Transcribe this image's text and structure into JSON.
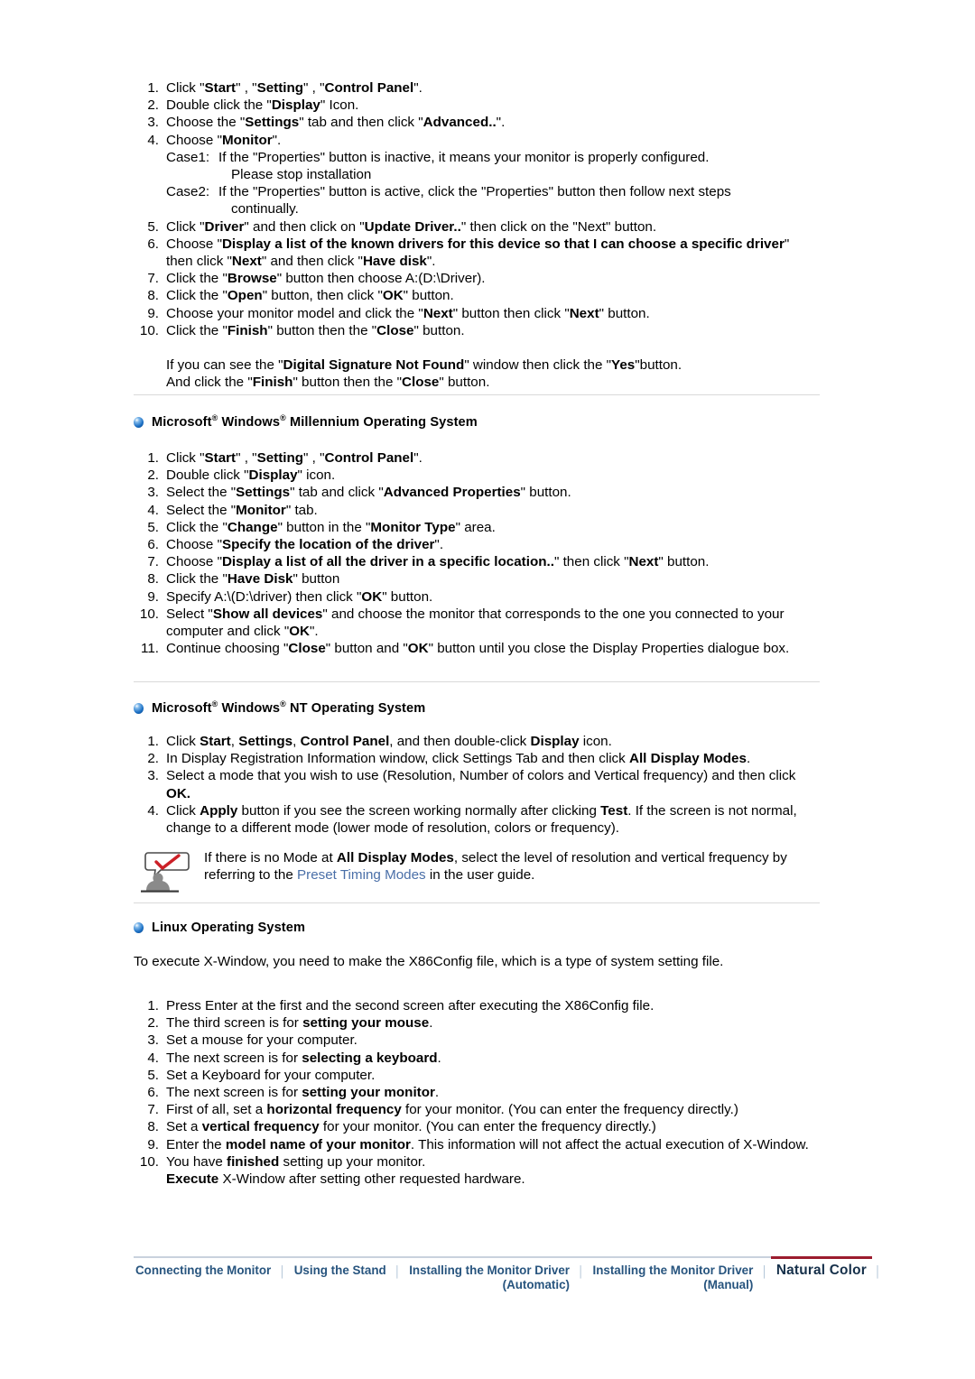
{
  "section_xp": {
    "steps": [
      {
        "n": "1.",
        "parts": [
          {
            "t": "Click \"",
            "b": false
          },
          {
            "t": "Start",
            "b": true
          },
          {
            "t": "\" , \"",
            "b": false
          },
          {
            "t": "Setting",
            "b": true
          },
          {
            "t": "\" , \"",
            "b": false
          },
          {
            "t": "Control Panel",
            "b": true
          },
          {
            "t": "\".",
            "b": false
          }
        ]
      },
      {
        "n": "2.",
        "parts": [
          {
            "t": "Double click the \"",
            "b": false
          },
          {
            "t": "Display",
            "b": true
          },
          {
            "t": "\" Icon.",
            "b": false
          }
        ]
      },
      {
        "n": "3.",
        "parts": [
          {
            "t": "Choose the \"",
            "b": false
          },
          {
            "t": "Settings",
            "b": true
          },
          {
            "t": "\" tab and then click \"",
            "b": false
          },
          {
            "t": "Advanced..",
            "b": true
          },
          {
            "t": "\".",
            "b": false
          }
        ]
      },
      {
        "n": "4.",
        "parts": [
          {
            "t": "Choose \"",
            "b": false
          },
          {
            "t": "Monitor",
            "b": true
          },
          {
            "t": "\".",
            "b": false
          }
        ]
      }
    ],
    "cases": [
      {
        "label": "Case1:",
        "lines": [
          "If the \"Properties\" button is inactive, it means your monitor is properly configured.",
          "Please stop installation"
        ]
      },
      {
        "label": "Case2:",
        "lines": [
          "If the \"Properties\" button is active, click the \"Properties\" button then follow next steps",
          "continually."
        ]
      }
    ],
    "steps2": [
      {
        "n": "5.",
        "parts": [
          {
            "t": "Click \"",
            "b": false
          },
          {
            "t": "Driver",
            "b": true
          },
          {
            "t": "\" and then click on \"",
            "b": false
          },
          {
            "t": "Update Driver..",
            "b": true
          },
          {
            "t": "\" then click on the \"Next\" button.",
            "b": false
          }
        ]
      },
      {
        "n": "6.",
        "parts": [
          {
            "t": "Choose \"",
            "b": false
          },
          {
            "t": "Display a list of the known drivers for this device so that I can choose a specific driver",
            "b": true
          },
          {
            "t": "\" then click \"",
            "b": false
          },
          {
            "t": "Next",
            "b": true
          },
          {
            "t": "\" and then click \"",
            "b": false
          },
          {
            "t": "Have disk",
            "b": true
          },
          {
            "t": "\".",
            "b": false
          }
        ]
      },
      {
        "n": "7.",
        "parts": [
          {
            "t": "Click the \"",
            "b": false
          },
          {
            "t": "Browse",
            "b": true
          },
          {
            "t": "\" button then choose A:(D:\\Driver).",
            "b": false
          }
        ]
      },
      {
        "n": "8.",
        "parts": [
          {
            "t": "Click the \"",
            "b": false
          },
          {
            "t": "Open",
            "b": true
          },
          {
            "t": "\" button, then click \"",
            "b": false
          },
          {
            "t": "OK",
            "b": true
          },
          {
            "t": "\" button.",
            "b": false
          }
        ]
      },
      {
        "n": "9.",
        "parts": [
          {
            "t": "Choose your monitor model and click the \"",
            "b": false
          },
          {
            "t": "Next",
            "b": true
          },
          {
            "t": "\" button then click \"",
            "b": false
          },
          {
            "t": "Next",
            "b": true
          },
          {
            "t": "\" button.",
            "b": false
          }
        ]
      },
      {
        "n": "10.",
        "parts": [
          {
            "t": "Click the \"",
            "b": false
          },
          {
            "t": "Finish",
            "b": true
          },
          {
            "t": "\" button then the \"",
            "b": false
          },
          {
            "t": "Close",
            "b": true
          },
          {
            "t": "\" button.",
            "b": false
          }
        ]
      }
    ],
    "note_lines": [
      [
        {
          "t": "If you can see the \"",
          "b": false
        },
        {
          "t": "Digital Signature Not Found",
          "b": true
        },
        {
          "t": "\" window then click the \"",
          "b": false
        },
        {
          "t": "Yes",
          "b": true
        },
        {
          "t": "\"button.",
          "b": false
        }
      ],
      [
        {
          "t": "And click the \"",
          "b": false
        },
        {
          "t": "Finish",
          "b": true
        },
        {
          "t": "\" button then the \"",
          "b": false
        },
        {
          "t": "Close",
          "b": true
        },
        {
          "t": "\" button.",
          "b": false
        }
      ]
    ]
  },
  "section_me": {
    "heading": {
      "icon": "blue-orb-bullet",
      "pre": "Microsoft",
      "reg1": "®",
      "mid": " Windows",
      "reg2": "®",
      "post": " Millennium Operating System"
    },
    "steps": [
      {
        "n": "1.",
        "parts": [
          {
            "t": "Click \"",
            "b": false
          },
          {
            "t": "Start",
            "b": true
          },
          {
            "t": "\" , \"",
            "b": false
          },
          {
            "t": "Setting",
            "b": true
          },
          {
            "t": "\" , \"",
            "b": false
          },
          {
            "t": "Control Panel",
            "b": true
          },
          {
            "t": "\".",
            "b": false
          }
        ]
      },
      {
        "n": "2.",
        "parts": [
          {
            "t": "Double click \"",
            "b": false
          },
          {
            "t": "Display",
            "b": true
          },
          {
            "t": "\" icon.",
            "b": false
          }
        ]
      },
      {
        "n": "3.",
        "parts": [
          {
            "t": "Select the \"",
            "b": false
          },
          {
            "t": "Settings",
            "b": true
          },
          {
            "t": "\" tab and click \"",
            "b": false
          },
          {
            "t": "Advanced Properties",
            "b": true
          },
          {
            "t": "\" button.",
            "b": false
          }
        ]
      },
      {
        "n": "4.",
        "parts": [
          {
            "t": "Select the \"",
            "b": false
          },
          {
            "t": "Monitor",
            "b": true
          },
          {
            "t": "\" tab.",
            "b": false
          }
        ]
      },
      {
        "n": "5.",
        "parts": [
          {
            "t": "Click the \"",
            "b": false
          },
          {
            "t": "Change",
            "b": true
          },
          {
            "t": "\" button in the \"",
            "b": false
          },
          {
            "t": "Monitor Type",
            "b": true
          },
          {
            "t": "\" area.",
            "b": false
          }
        ]
      },
      {
        "n": "6.",
        "parts": [
          {
            "t": "Choose \"",
            "b": false
          },
          {
            "t": "Specify the location of the driver",
            "b": true
          },
          {
            "t": "\".",
            "b": false
          }
        ]
      },
      {
        "n": "7.",
        "parts": [
          {
            "t": "Choose \"",
            "b": false
          },
          {
            "t": "Display a list of all the driver in a specific location..",
            "b": true
          },
          {
            "t": "\" then click \"",
            "b": false
          },
          {
            "t": "Next",
            "b": true
          },
          {
            "t": "\" button.",
            "b": false
          }
        ]
      },
      {
        "n": "8.",
        "parts": [
          {
            "t": "Click the \"",
            "b": false
          },
          {
            "t": "Have Disk",
            "b": true
          },
          {
            "t": "\" button",
            "b": false
          }
        ]
      },
      {
        "n": "9.",
        "parts": [
          {
            "t": "Specify A:\\(D:\\driver) then click \"",
            "b": false
          },
          {
            "t": "OK",
            "b": true
          },
          {
            "t": "\" button.",
            "b": false
          }
        ]
      },
      {
        "n": "10.",
        "parts": [
          {
            "t": "Select \"",
            "b": false
          },
          {
            "t": "Show all devices",
            "b": true
          },
          {
            "t": "\" and choose the monitor that corresponds to the one you connected to your computer and click \"",
            "b": false
          },
          {
            "t": "OK",
            "b": true
          },
          {
            "t": "\".",
            "b": false
          }
        ]
      },
      {
        "n": "11.",
        "parts": [
          {
            "t": "Continue choosing \"",
            "b": false
          },
          {
            "t": "Close",
            "b": true
          },
          {
            "t": "\" button and \"",
            "b": false
          },
          {
            "t": "OK",
            "b": true
          },
          {
            "t": "\" button until you close the Display Properties dialogue box.",
            "b": false
          }
        ]
      }
    ]
  },
  "section_nt": {
    "heading": {
      "icon": "blue-orb-bullet",
      "pre": "Microsoft",
      "reg1": "®",
      "mid": " Windows",
      "reg2": "®",
      "post": " NT Operating System"
    },
    "steps": [
      {
        "n": "1.",
        "parts": [
          {
            "t": "Click ",
            "b": false
          },
          {
            "t": "Start",
            "b": true
          },
          {
            "t": ", ",
            "b": false
          },
          {
            "t": "Settings",
            "b": true
          },
          {
            "t": ", ",
            "b": false
          },
          {
            "t": "Control Panel",
            "b": true
          },
          {
            "t": ", and then double-click ",
            "b": false
          },
          {
            "t": "Display",
            "b": true
          },
          {
            "t": " icon.",
            "b": false
          }
        ]
      },
      {
        "n": "2.",
        "parts": [
          {
            "t": "In Display Registration Information window, click Settings Tab and then click ",
            "b": false
          },
          {
            "t": "All Display Modes",
            "b": true
          },
          {
            "t": ".",
            "b": false
          }
        ]
      },
      {
        "n": "3.",
        "parts": [
          {
            "t": "Select a mode that you wish to use (Resolution, Number of colors and Vertical frequency) and then click ",
            "b": false
          },
          {
            "t": "OK.",
            "b": true
          }
        ]
      },
      {
        "n": "4.",
        "parts": [
          {
            "t": "Click ",
            "b": false
          },
          {
            "t": "Apply",
            "b": true
          },
          {
            "t": " button if you see the screen working normally after clicking ",
            "b": false
          },
          {
            "t": "Test",
            "b": true
          },
          {
            "t": ". If the screen is not normal, change to a different mode (lower mode of resolution, colors or frequency).",
            "b": false
          }
        ]
      }
    ],
    "note": {
      "icon": "person-with-checkmark-speech-bubble-icon",
      "parts": [
        {
          "t": "If there is no Mode at ",
          "b": false,
          "link": false
        },
        {
          "t": "All Display Modes",
          "b": true,
          "link": false
        },
        {
          "t": ", select the level of resolution and vertical frequency by referring to the ",
          "b": false,
          "link": false
        },
        {
          "t": "Preset Timing Modes",
          "b": false,
          "link": true
        },
        {
          "t": " in the user guide.",
          "b": false,
          "link": false
        }
      ]
    }
  },
  "section_linux": {
    "heading": {
      "icon": "blue-orb-bullet",
      "pre": "Linux Operating System",
      "reg1": "",
      "mid": "",
      "reg2": "",
      "post": ""
    },
    "intro": "To execute X-Window, you need to make the X86Config file, which is a type of system setting file.",
    "steps": [
      {
        "n": "1.",
        "parts": [
          {
            "t": "Press Enter at the first and the second screen after executing the X86Config file.",
            "b": false
          }
        ]
      },
      {
        "n": "2.",
        "parts": [
          {
            "t": "The third screen is for ",
            "b": false
          },
          {
            "t": "setting your mouse",
            "b": true
          },
          {
            "t": ".",
            "b": false
          }
        ]
      },
      {
        "n": "3.",
        "parts": [
          {
            "t": "Set a mouse for your computer.",
            "b": false
          }
        ]
      },
      {
        "n": "4.",
        "parts": [
          {
            "t": "The next screen is for ",
            "b": false
          },
          {
            "t": "selecting a keyboard",
            "b": true
          },
          {
            "t": ".",
            "b": false
          }
        ]
      },
      {
        "n": "5.",
        "parts": [
          {
            "t": "Set a Keyboard for your computer.",
            "b": false
          }
        ]
      },
      {
        "n": "6.",
        "parts": [
          {
            "t": "The next screen is for ",
            "b": false
          },
          {
            "t": "setting your monitor",
            "b": true
          },
          {
            "t": ".",
            "b": false
          }
        ]
      },
      {
        "n": "7.",
        "parts": [
          {
            "t": "First of all, set a ",
            "b": false
          },
          {
            "t": "horizontal frequency",
            "b": true
          },
          {
            "t": " for your monitor. (You can enter the frequency directly.)",
            "b": false
          }
        ]
      },
      {
        "n": "8.",
        "parts": [
          {
            "t": "Set a ",
            "b": false
          },
          {
            "t": "vertical frequency",
            "b": true
          },
          {
            "t": " for your monitor. (You can enter the frequency directly.)",
            "b": false
          }
        ]
      },
      {
        "n": "9.",
        "parts": [
          {
            "t": "Enter the ",
            "b": false
          },
          {
            "t": "model name of your monitor",
            "b": true
          },
          {
            "t": ". This information will not affect the actual execution of X-Window.",
            "b": false
          }
        ]
      },
      {
        "n": "10.",
        "parts": [
          {
            "t": "You have ",
            "b": false
          },
          {
            "t": "finished",
            "b": true
          },
          {
            "t": " setting up your monitor.",
            "b": false
          },
          {
            "t": "\n",
            "b": false
          },
          {
            "t": "Execute",
            "b": true
          },
          {
            "t": " X-Window after setting other requested hardware.",
            "b": false
          }
        ]
      }
    ]
  },
  "footer": {
    "items": [
      {
        "label": "Connecting  the Monitor",
        "sub": "",
        "active": false
      },
      {
        "label": "Using the Stand",
        "sub": "",
        "active": false
      },
      {
        "label": "Installing the Monitor Driver",
        "sub": "(Automatic)",
        "active": false
      },
      {
        "label": "Installing the Monitor Driver",
        "sub": "(Manual)",
        "active": false
      },
      {
        "label": "Natural Color",
        "sub": "",
        "active": true
      }
    ],
    "separator": "│",
    "accent_color": "#9b1c2e",
    "link_color": "#27547e",
    "rule_color": "#c9d2dd"
  }
}
